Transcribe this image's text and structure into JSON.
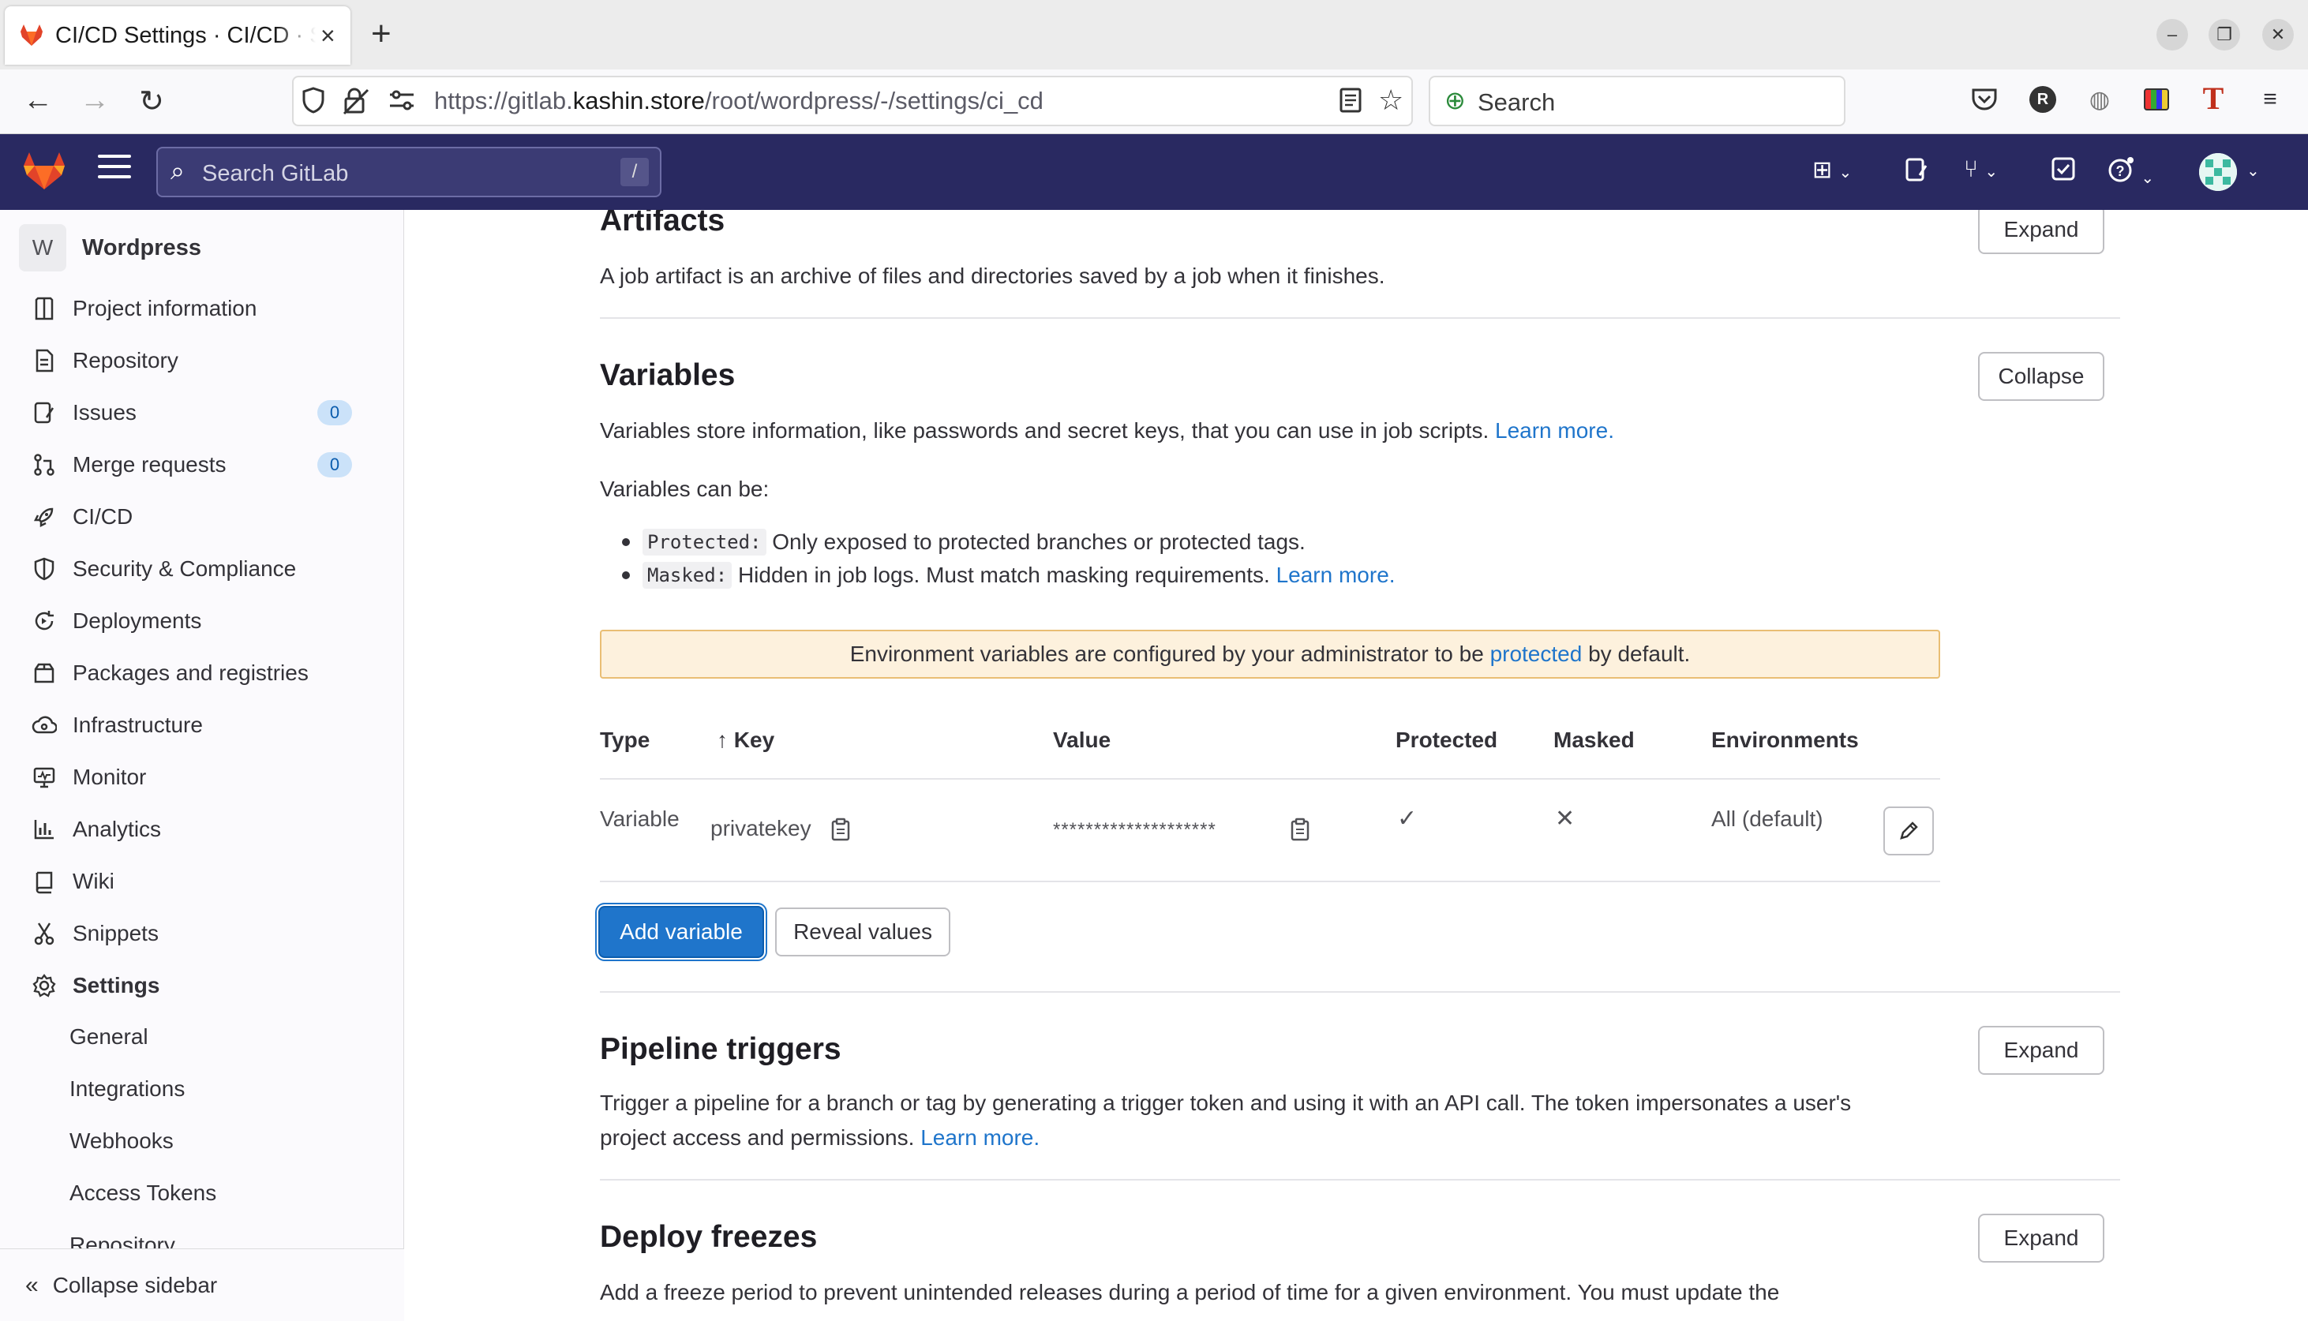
{
  "browser": {
    "tab_title": "CI/CD Settings · CI/CD · Settings",
    "url_prefix": "https://gitlab.",
    "url_domain": "kashin.store",
    "url_path": "/root/wordpress/-/settings/ci_cd",
    "search_placeholder": "Search"
  },
  "gitlab_bar": {
    "search_placeholder": "Search GitLab",
    "search_shortcut": "/"
  },
  "sidebar": {
    "project_initial": "W",
    "project_name": "Wordpress",
    "items": [
      {
        "label": "Project information",
        "icon": "project-icon"
      },
      {
        "label": "Repository",
        "icon": "repository-icon"
      },
      {
        "label": "Issues",
        "icon": "issues-icon",
        "badge": "0"
      },
      {
        "label": "Merge requests",
        "icon": "merge-request-icon",
        "badge": "0"
      },
      {
        "label": "CI/CD",
        "icon": "rocket-icon"
      },
      {
        "label": "Security & Compliance",
        "icon": "shield-icon"
      },
      {
        "label": "Deployments",
        "icon": "deployments-icon"
      },
      {
        "label": "Packages and registries",
        "icon": "package-icon"
      },
      {
        "label": "Infrastructure",
        "icon": "cloud-gear-icon"
      },
      {
        "label": "Monitor",
        "icon": "monitor-icon"
      },
      {
        "label": "Analytics",
        "icon": "chart-icon"
      },
      {
        "label": "Wiki",
        "icon": "book-icon"
      },
      {
        "label": "Snippets",
        "icon": "snippet-icon"
      },
      {
        "label": "Settings",
        "icon": "gear-icon"
      }
    ],
    "settings_sub": [
      "General",
      "Integrations",
      "Webhooks",
      "Access Tokens",
      "Repository"
    ],
    "collapse_label": "Collapse sidebar"
  },
  "artifacts": {
    "title": "Artifacts",
    "description": "A job artifact is an archive of files and directories saved by a job when it finishes.",
    "button": "Expand"
  },
  "variables": {
    "title": "Variables",
    "button": "Collapse",
    "description": "Variables store information, like passwords and secret keys, that you can use in job scripts.",
    "learn_more": "Learn more.",
    "can_be": "Variables can be:",
    "bullets": [
      {
        "code": "Protected:",
        "text": "Only exposed to protected branches or protected tags.",
        "link": ""
      },
      {
        "code": "Masked:",
        "text": "Hidden in job logs. Must match masking requirements.",
        "link": "Learn more."
      }
    ],
    "alert_before": "Environment variables are configured by your administrator to be ",
    "alert_link": "protected",
    "alert_after": " by default.",
    "table": {
      "headers": {
        "type": "Type",
        "key": "Key",
        "value": "Value",
        "protected": "Protected",
        "masked": "Masked",
        "environments": "Environments"
      },
      "rows": [
        {
          "type": "Variable",
          "key": "privatekey",
          "value": "********************",
          "protected": "✓",
          "masked": "✕",
          "environments": "All (default)"
        }
      ]
    },
    "add_button": "Add variable",
    "reveal_button": "Reveal values"
  },
  "pipeline_triggers": {
    "title": "Pipeline triggers",
    "button": "Expand",
    "description_line1": "Trigger a pipeline for a branch or tag by generating a trigger token and using it with an API call. The token impersonates a user's",
    "description_line2": "project access and permissions.",
    "learn_more": "Learn more."
  },
  "deploy_freezes": {
    "title": "Deploy freezes",
    "button": "Expand",
    "description_line1": "Add a freeze period to prevent unintended releases during a period of time for a given environment. You must update the"
  },
  "colors": {
    "gitlab_nav": "#292961",
    "link": "#1f75cb",
    "primary_button": "#1f75cb",
    "alert_bg": "#fdf1dd"
  }
}
